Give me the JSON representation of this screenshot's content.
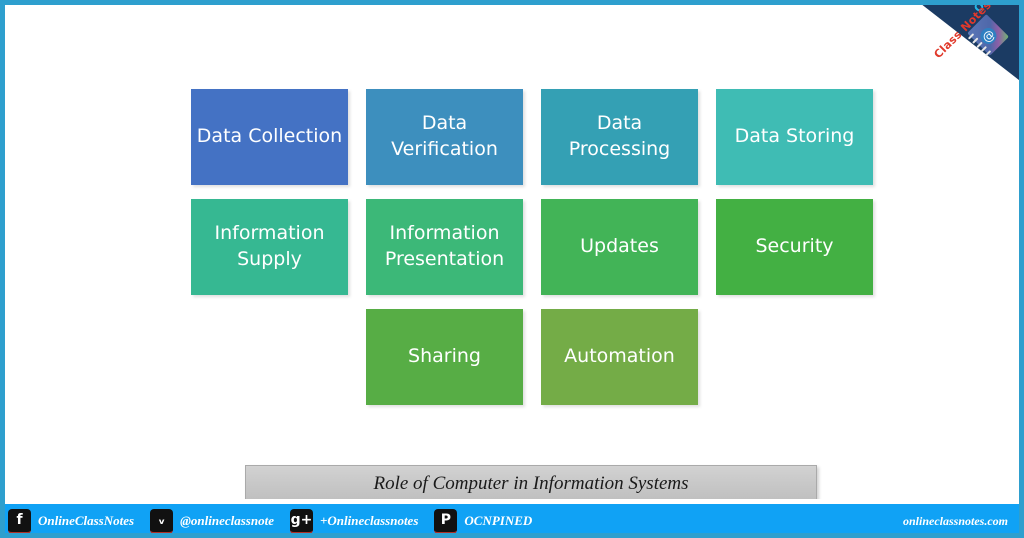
{
  "theme": {
    "frame_border": "#2e9fce",
    "page_background": "#ffffff",
    "footer_background": "#10a2f5",
    "ribbon_background": "#1b3b63",
    "caption_background": "#c8c8c8"
  },
  "logo": {
    "word_online": "Online",
    "word_classnotes": "Class Notes",
    "online_color": "#22b7e8",
    "classnotes_color": "#e0392b",
    "notebook_icon": "notebook-icon",
    "badge_glyph": "@"
  },
  "diagram": {
    "rows": [
      [
        {
          "label": "Data Collection",
          "color": "#4472c4"
        },
        {
          "label": "Data Verification",
          "color": "#3d8fbe"
        },
        {
          "label": "Data Processing",
          "color": "#34a0b4"
        },
        {
          "label": "Data Storing",
          "color": "#3fbcb4"
        }
      ],
      [
        {
          "label": "Information Supply",
          "color": "#36b892"
        },
        {
          "label": "Information Presentation",
          "color": "#3cb878"
        },
        {
          "label": "Updates",
          "color": "#42b457"
        },
        {
          "label": "Security",
          "color": "#43b043"
        }
      ],
      [
        {
          "label": "",
          "color": "transparent",
          "spacer": true
        },
        {
          "label": "Sharing",
          "color": "#57ad45"
        },
        {
          "label": "Automation",
          "color": "#74ac47"
        },
        {
          "label": "",
          "color": "transparent",
          "spacer": true
        }
      ]
    ]
  },
  "caption": {
    "text": "Role of Computer in Information Systems"
  },
  "footer": {
    "socials": [
      {
        "icon": "facebook-icon",
        "glyph": "f",
        "label": "OnlineClassNotes"
      },
      {
        "icon": "twitter-icon",
        "glyph": "ᵥ",
        "label": "@onlineclassnote"
      },
      {
        "icon": "google-plus-icon",
        "glyph": "g+",
        "label": "+Onlineclassnotes"
      },
      {
        "icon": "pinterest-icon",
        "glyph": "P",
        "label": "OCNPINED"
      }
    ],
    "site": "onlineclassnotes.com"
  }
}
